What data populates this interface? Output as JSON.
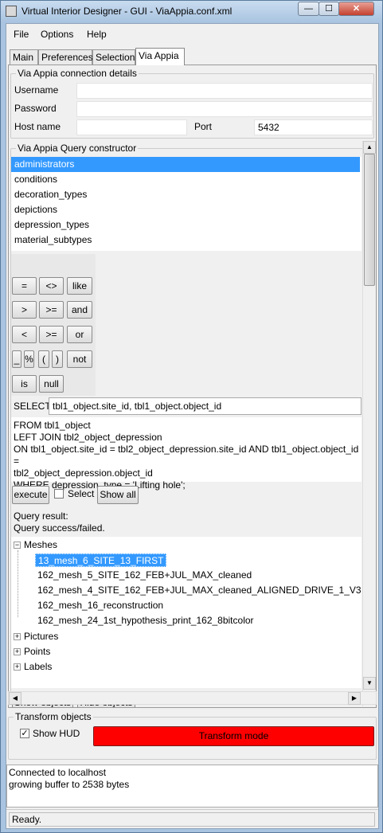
{
  "window": {
    "title": "Virtual Interior Designer - GUI - ViaAppia.conf.xml",
    "minimize_glyph": "—",
    "maximize_glyph": "☐",
    "close_glyph": "✕"
  },
  "menu": {
    "file": "File",
    "options": "Options",
    "help": "Help"
  },
  "tabs": [
    "Main",
    "Preferences",
    "Selection",
    "Via Appia"
  ],
  "connection": {
    "title": "Via Appia connection details",
    "username_label": "Username",
    "username_value": "",
    "password_label": "Password",
    "password_value": "",
    "host_label": "Host name",
    "host_value": "",
    "port_label": "Port",
    "port_value": "5432"
  },
  "query": {
    "title": "Via Appia Query constructor",
    "tables": [
      "administrators",
      "conditions",
      "decoration_types",
      "depictions",
      "depression_types",
      "material_subtypes"
    ],
    "selected_table": "administrators",
    "operators": {
      "eq": "=",
      "neq": "<>",
      "like": "like",
      "gt": ">",
      "gte": ">=",
      "and": "and",
      "lt": "<",
      "lte": ">=",
      "or": "or",
      "underscore": "_",
      "percent": "%",
      "lparen": "(",
      "rparen": ")",
      "not": "not",
      "is": "is",
      "null": "null"
    },
    "select_label": "SELECT",
    "select_value": "tbl1_object.site_id, tbl1_object.object_id",
    "sql_lines": [
      "FROM tbl1_object",
      "LEFT JOIN tbl2_object_depression",
      "ON tbl1_object.site_id = tbl2_object_depression.site_id AND tbl1_object.object_id =",
      "tbl2_object_depression.object_id",
      "WHERE depression_type = 'Lifting hole';"
    ],
    "execute_label": "execute",
    "select_checkbox_label": "Select",
    "show_all_label": "Show all",
    "result_lines": [
      "Query result:",
      "Query success/failed."
    ]
  },
  "tree": {
    "meshes_label": "Meshes",
    "meshes": [
      "13_mesh_6_SITE_13_FIRST",
      "162_mesh_5_SITE_162_FEB+JUL_MAX_cleaned",
      "162_mesh_4_SITE_162_FEB+JUL_MAX_cleaned_ALIGNED_DRIVE_1_V3",
      "162_mesh_16_reconstruction",
      "162_mesh_24_1st_hypothesis_print_162_8bitcolor"
    ],
    "selected_mesh": "13_mesh_6_SITE_13_FIRST",
    "pictures_label": "Pictures",
    "points_label": "Points",
    "labels_label": "Labels",
    "expand_glyph": "+",
    "collapse_glyph": "−"
  },
  "tree_buttons": {
    "show_objects": "Show objects",
    "hide_objects": "Hide objects"
  },
  "transform": {
    "title": "Transform objects",
    "show_hud_label": "Show HUD",
    "show_hud_checked": true,
    "check_glyph": "✓",
    "mode_label": "Transform mode",
    "mode_color": "#ff0000"
  },
  "log": {
    "lines": [
      "Connected to localhost",
      "growing buffer to 2538 bytes"
    ]
  },
  "status": {
    "text": "Ready."
  },
  "scroll_glyphs": {
    "up": "▲",
    "down": "▼",
    "left": "◀",
    "right": "▶"
  }
}
